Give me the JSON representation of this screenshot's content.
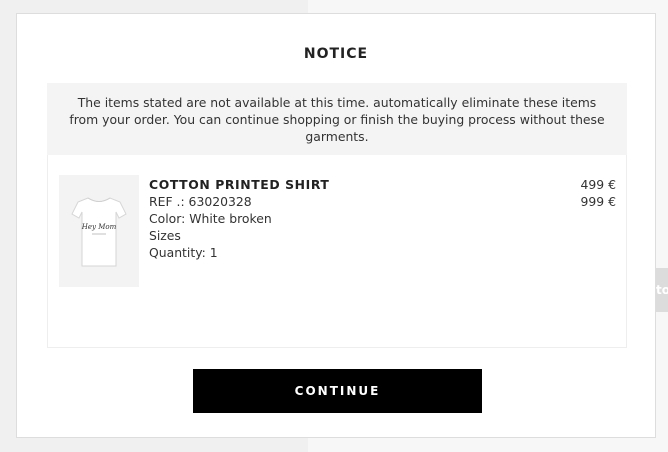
{
  "background": {
    "side_tab_text": "to"
  },
  "modal": {
    "title": "NOTICE",
    "message": "The items stated are not available at this time. automatically eliminate these items from your order. You can continue shopping or finish the buying process without these garments.",
    "product": {
      "name": "COTTON PRINTED SHIRT",
      "ref": "REF .: 63020328",
      "color": "Color: White broken",
      "sizes": "Sizes",
      "quantity": "Quantity: 1",
      "price_1": "499 €",
      "price_2": "999 €",
      "image_print_text": "Hey Mom"
    },
    "continue_label": "CONTINUE"
  },
  "colors": {
    "button_bg": "#000000",
    "button_text": "#ffffff",
    "notice_bg": "#f4f4f4"
  },
  "icons": {
    "product_image": "t-shirt-icon"
  }
}
